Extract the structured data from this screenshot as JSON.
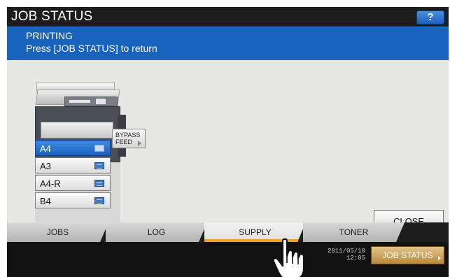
{
  "header": {
    "title": "JOB STATUS",
    "help_label": "?"
  },
  "banner": {
    "line1": "PRINTING",
    "line2": "Press [JOB STATUS] to return"
  },
  "trays": [
    {
      "label": "A4",
      "selected": true
    },
    {
      "label": "A3",
      "selected": false
    },
    {
      "label": "A4-R",
      "selected": false
    },
    {
      "label": "B4",
      "selected": false
    }
  ],
  "bypass": {
    "line1": "BYPASS",
    "line2": "FEED"
  },
  "close_label": "CLOSE",
  "tabs": [
    {
      "label": "JOBS",
      "active": false
    },
    {
      "label": "LOG",
      "active": false
    },
    {
      "label": "SUPPLY",
      "active": true
    },
    {
      "label": "TONER",
      "active": false
    }
  ],
  "footer": {
    "date": "2011/05/10",
    "time": "12:05",
    "jobstatus_label": "JOB STATUS"
  },
  "colors": {
    "banner": "#1763bd",
    "title_bar": "#1d1d1d",
    "selected_tray": "#1862c0",
    "active_tab_underline": "#f0a224",
    "jobstatus_button": "#b9893a"
  },
  "icons": [
    "help-icon",
    "paper-tray-icon",
    "hand-pointer-icon"
  ]
}
